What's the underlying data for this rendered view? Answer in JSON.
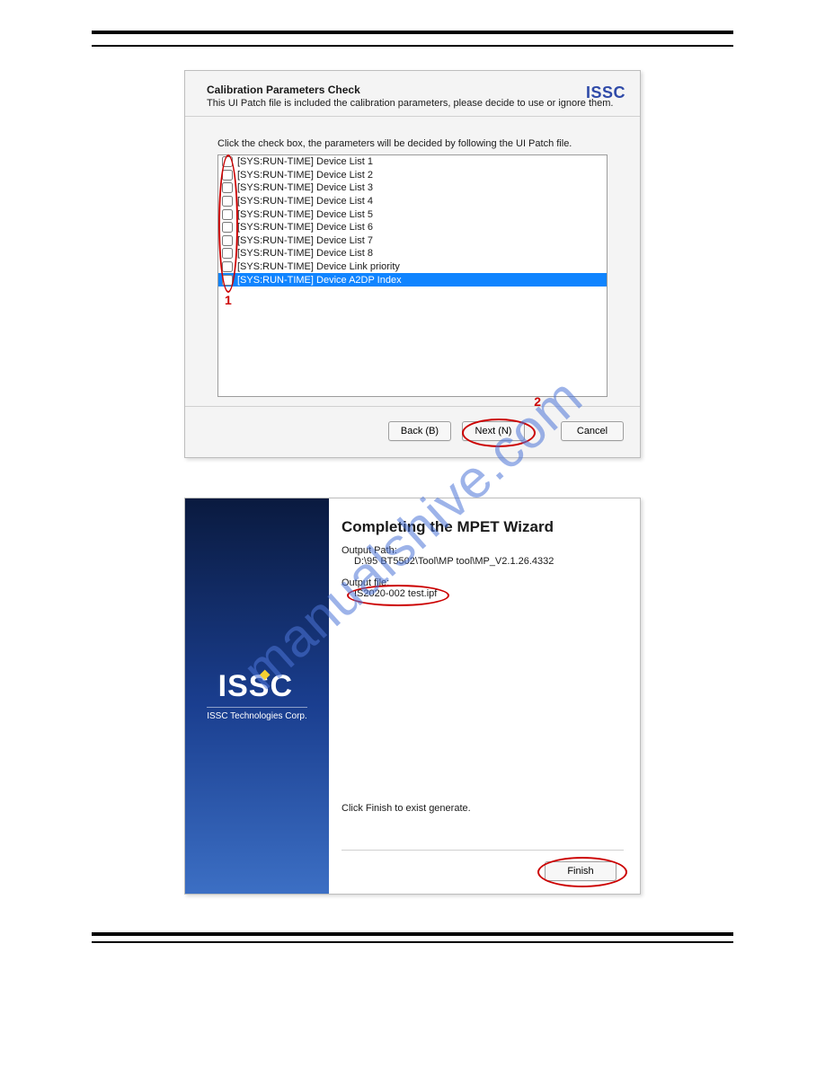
{
  "dialog1": {
    "title": "Calibration Parameters Check",
    "subtitle": "This UI Patch file is included the calibration parameters, please decide to use or ignore them.",
    "logo": "ISSC",
    "instruction": "Click the check box, the parameters will be decided by following the UI Patch file.",
    "items": [
      {
        "label": "[SYS:RUN-TIME] Device List 1",
        "selected": false
      },
      {
        "label": "[SYS:RUN-TIME] Device List 2",
        "selected": false
      },
      {
        "label": "[SYS:RUN-TIME] Device List 3",
        "selected": false
      },
      {
        "label": "[SYS:RUN-TIME] Device List 4",
        "selected": false
      },
      {
        "label": "[SYS:RUN-TIME] Device List 5",
        "selected": false
      },
      {
        "label": "[SYS:RUN-TIME] Device List 6",
        "selected": false
      },
      {
        "label": "[SYS:RUN-TIME] Device List 7",
        "selected": false
      },
      {
        "label": "[SYS:RUN-TIME] Device List 8",
        "selected": false
      },
      {
        "label": "[SYS:RUN-TIME] Device Link priority",
        "selected": false
      },
      {
        "label": "[SYS:RUN-TIME] Device A2DP Index",
        "selected": true
      }
    ],
    "callouts": {
      "n1": "1",
      "n2": "2"
    },
    "buttons": {
      "back": "Back (B)",
      "next": "Next (N)",
      "cancel": "Cancel"
    }
  },
  "wizard": {
    "logo": "ISSC",
    "logo_sub": "ISSC Technologies Corp.",
    "title": "Completing the MPET Wizard",
    "out_path_label": "Output Path:",
    "out_path_value": "D:\\95 BT5502\\Tool\\MP tool\\MP_V2.1.26.4332",
    "out_file_label": "Output file:",
    "out_file_value": "IS2020-002 test.ipf",
    "finish_msg": "Click Finish to exist generate.",
    "finish_btn": "Finish"
  },
  "watermark": "manualshive.com"
}
